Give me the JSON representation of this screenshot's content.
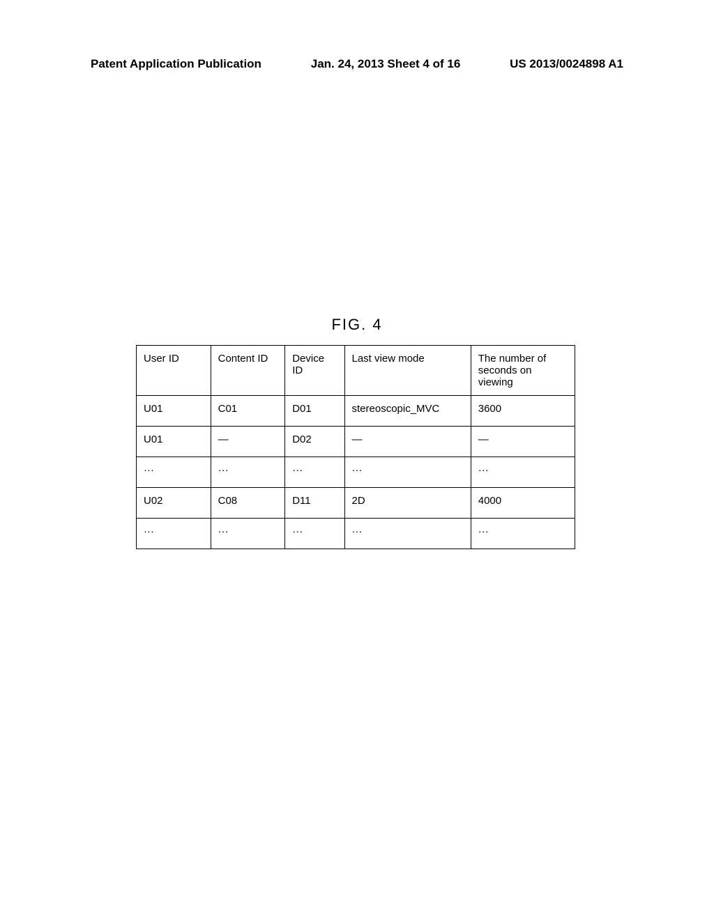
{
  "header": {
    "left": "Patent Application Publication",
    "center": "Jan. 24, 2013  Sheet 4 of 16",
    "right": "US 2013/0024898 A1"
  },
  "figure_label": "FIG. 4",
  "chart_data": {
    "type": "table",
    "columns": [
      "User ID",
      "Content ID",
      "Device ID",
      "Last view mode",
      "The number of seconds on viewing"
    ],
    "rows": [
      [
        "U01",
        "C01",
        "D01",
        "stereoscopic_MVC",
        "3600"
      ],
      [
        "U01",
        "—",
        "D02",
        "—",
        "—"
      ],
      [
        "···",
        "···",
        "···",
        "···",
        "···"
      ],
      [
        "U02",
        "C08",
        "D11",
        "2D",
        "4000"
      ],
      [
        "···",
        "···",
        "···",
        "···",
        "···"
      ]
    ]
  }
}
